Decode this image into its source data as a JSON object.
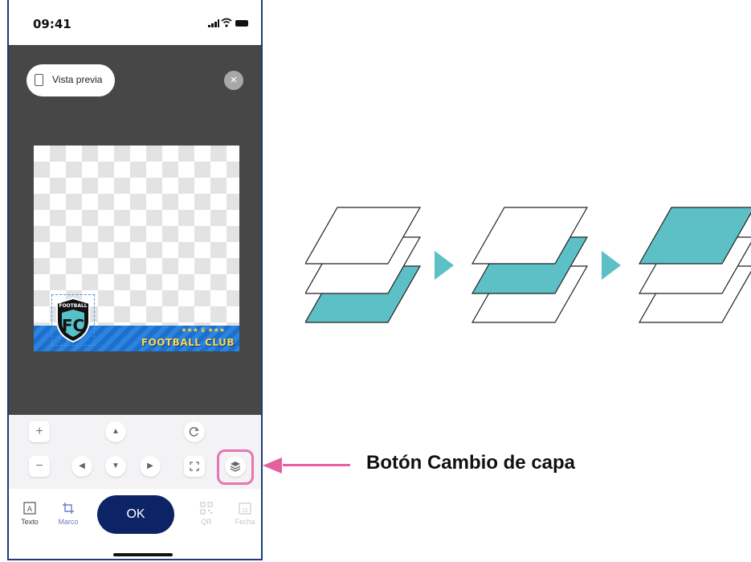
{
  "status_bar": {
    "time": "09:41"
  },
  "editor": {
    "preview_label": "Vista previa",
    "close_symbol": "×",
    "artwork": {
      "badge_top_text": "FOOTBALL",
      "badge_letters": "FC",
      "stars_text": "★★★ ♛ ★★★",
      "banner_text": "FOOTBALL CLUB"
    }
  },
  "controls": {
    "zoom_in": "+",
    "zoom_out": "−",
    "move_up": "▲",
    "move_down": "▼",
    "move_left": "◀",
    "move_right": "▶",
    "rotate_icon": "rotate-icon",
    "fit_icon": "fit-icon",
    "layer_icon": "layer-switch-icon"
  },
  "tabbar": {
    "tabs": [
      {
        "label": "Texto",
        "icon": "text-icon",
        "state": "normal"
      },
      {
        "label": "Marco",
        "icon": "crop-icon",
        "state": "selected"
      },
      {
        "label": "QR",
        "icon": "qr-icon",
        "state": "disabled"
      },
      {
        "label": "Fecha",
        "icon": "calendar-icon",
        "state": "disabled"
      }
    ],
    "ok_label": "OK",
    "calendar_day": "12"
  },
  "annotation": {
    "caption": "Botón Cambio de capa",
    "arrow_color": "#e5609f",
    "highlight_color": "#e774b3"
  },
  "layer_diagram": {
    "fill_color": "#5cc0c6",
    "stages": [
      {
        "highlighted_layer": "bottom"
      },
      {
        "highlighted_layer": "middle"
      },
      {
        "highlighted_layer": "top"
      }
    ]
  }
}
